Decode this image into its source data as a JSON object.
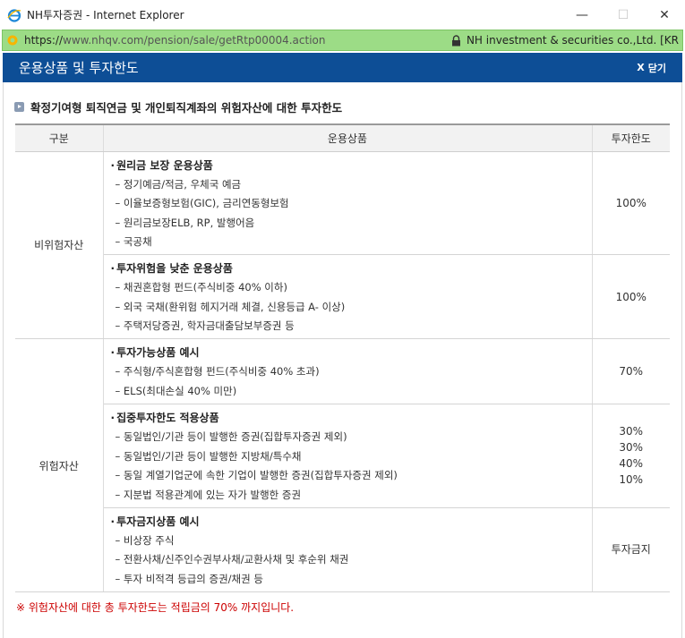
{
  "window": {
    "title": "NH투자증권 - Internet Explorer",
    "minimize": "—",
    "maximize": "☐",
    "close": "✕"
  },
  "address": {
    "url_prefix": "https://",
    "url_rest": "www.nhqv.com/pension/sale/getRtp00004.action",
    "site_identity": "NH investment & securities co.,Ltd. [KR"
  },
  "popup": {
    "title": "운용상품 및 투자한도",
    "close_label": "닫기",
    "close_x": "X"
  },
  "section_title": "확정기여형 퇴직연금 및 개인퇴직계좌의 위험자산에 대한 투자한도",
  "table": {
    "headers": [
      "구분",
      "운용상품",
      "투자한도"
    ],
    "groups": [
      {
        "category": "비위험자산",
        "rows": [
          {
            "title": "원리금 보장 운용상품",
            "items": [
              "– 정기예금/적금, 우체국 예금",
              "– 이율보증형보험(GIC), 금리연동형보험",
              "– 원리금보장ELB, RP, 발행어음",
              "– 국공채"
            ],
            "limits": [
              "100%"
            ]
          },
          {
            "title": "투자위험을 낮춘 운용상품",
            "items": [
              "– 채권혼합형 펀드(주식비중 40% 이하)",
              "– 외국 국채(환위험 헤지거래 체결, 신용등급 A- 이상)",
              "– 주택저당증권, 학자금대출담보부증권 등"
            ],
            "limits": [
              "100%"
            ]
          }
        ]
      },
      {
        "category": "위험자산",
        "rows": [
          {
            "title": "투자가능상품 예시",
            "items": [
              "– 주식형/주식혼합형 펀드(주식비중 40% 초과)",
              "– ELS(최대손실 40% 미만)"
            ],
            "limits": [
              "70%"
            ]
          },
          {
            "title": "집중투자한도 적용상품",
            "items": [
              "– 동일법인/기관 등이 발행한 증권(집합투자증권 제외)",
              "– 동일법인/기관 등이 발행한 지방채/특수채",
              "– 동일 계열기업군에 속한 기업이 발행한 증권(집합투자증권 제외)",
              "– 지분법 적용관계에 있는 자가 발행한 증권"
            ],
            "limits": [
              "30%",
              "30%",
              "40%",
              "10%"
            ]
          },
          {
            "title": "투자금지상품 예시",
            "items": [
              "– 비상장 주식",
              "– 전환사채/신주인수권부사채/교환사채 및 후순위 채권",
              "– 투자 비적격 등급의 증권/채권 등"
            ],
            "limits": [
              "투자금지"
            ]
          }
        ]
      }
    ]
  },
  "note": "※ 위험자산에 대한 총 투자한도는 적립금의 70% 까지입니다.",
  "colors": {
    "header_blue": "#0d4e96",
    "address_green": "#9cdc86",
    "note_red": "#cc0000"
  }
}
